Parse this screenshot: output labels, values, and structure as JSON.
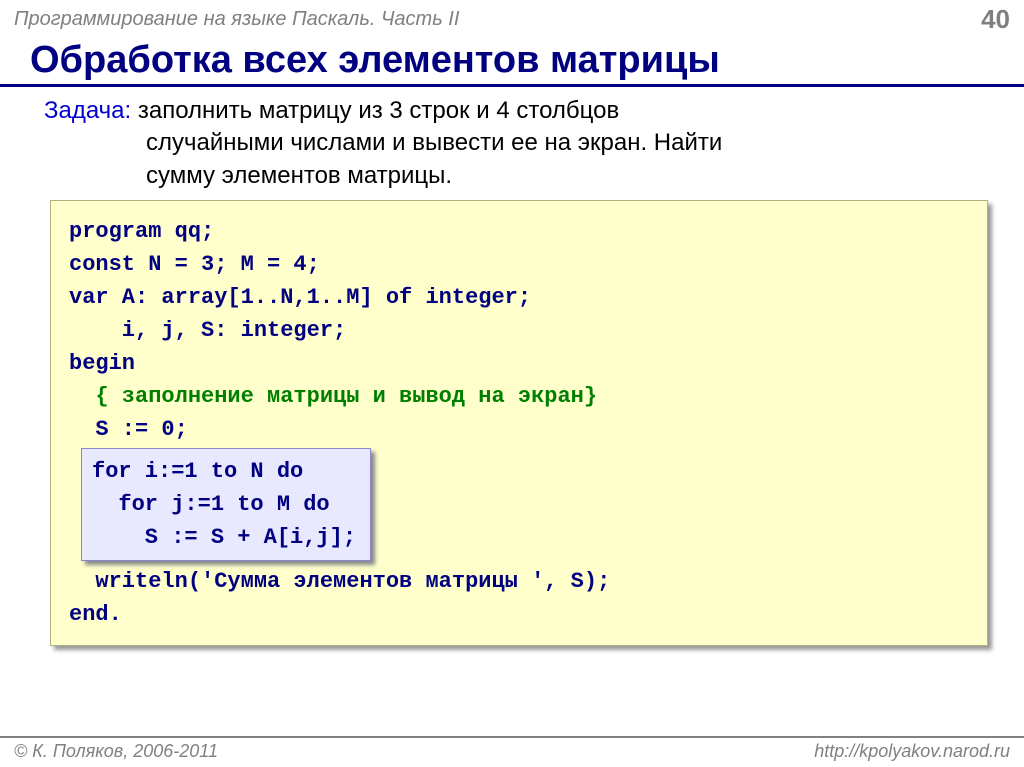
{
  "header": {
    "title": "Программирование на языке Паскаль. Часть II",
    "page": "40"
  },
  "slide_title": "Обработка всех элементов матрицы",
  "task": {
    "label": "Задача:",
    "line1": " заполнить матрицу из 3 строк и 4 столбцов",
    "line2": "случайными числами и вывести ее на экран. Найти",
    "line3": "сумму элементов матрицы."
  },
  "code": {
    "l1": "program qq;",
    "l2": "const N = 3; M = 4;",
    "l3": "var A: array[1..N,1..M] of integer;",
    "l4": "    i, j, S: integer;",
    "l5": "begin",
    "l6": "  { заполнение матрицы и вывод на экран}",
    "l7": "  S := 0;",
    "inner1": "for i:=1 to N do",
    "inner2": "  for j:=1 to M do",
    "inner3": "    S := S + A[i,j];",
    "l9": "  writeln('Сумма элементов матрицы ', S);",
    "l10": "end."
  },
  "footer": {
    "copyright": "© К. Поляков, 2006-2011",
    "url": "http://kpolyakov.narod.ru"
  }
}
